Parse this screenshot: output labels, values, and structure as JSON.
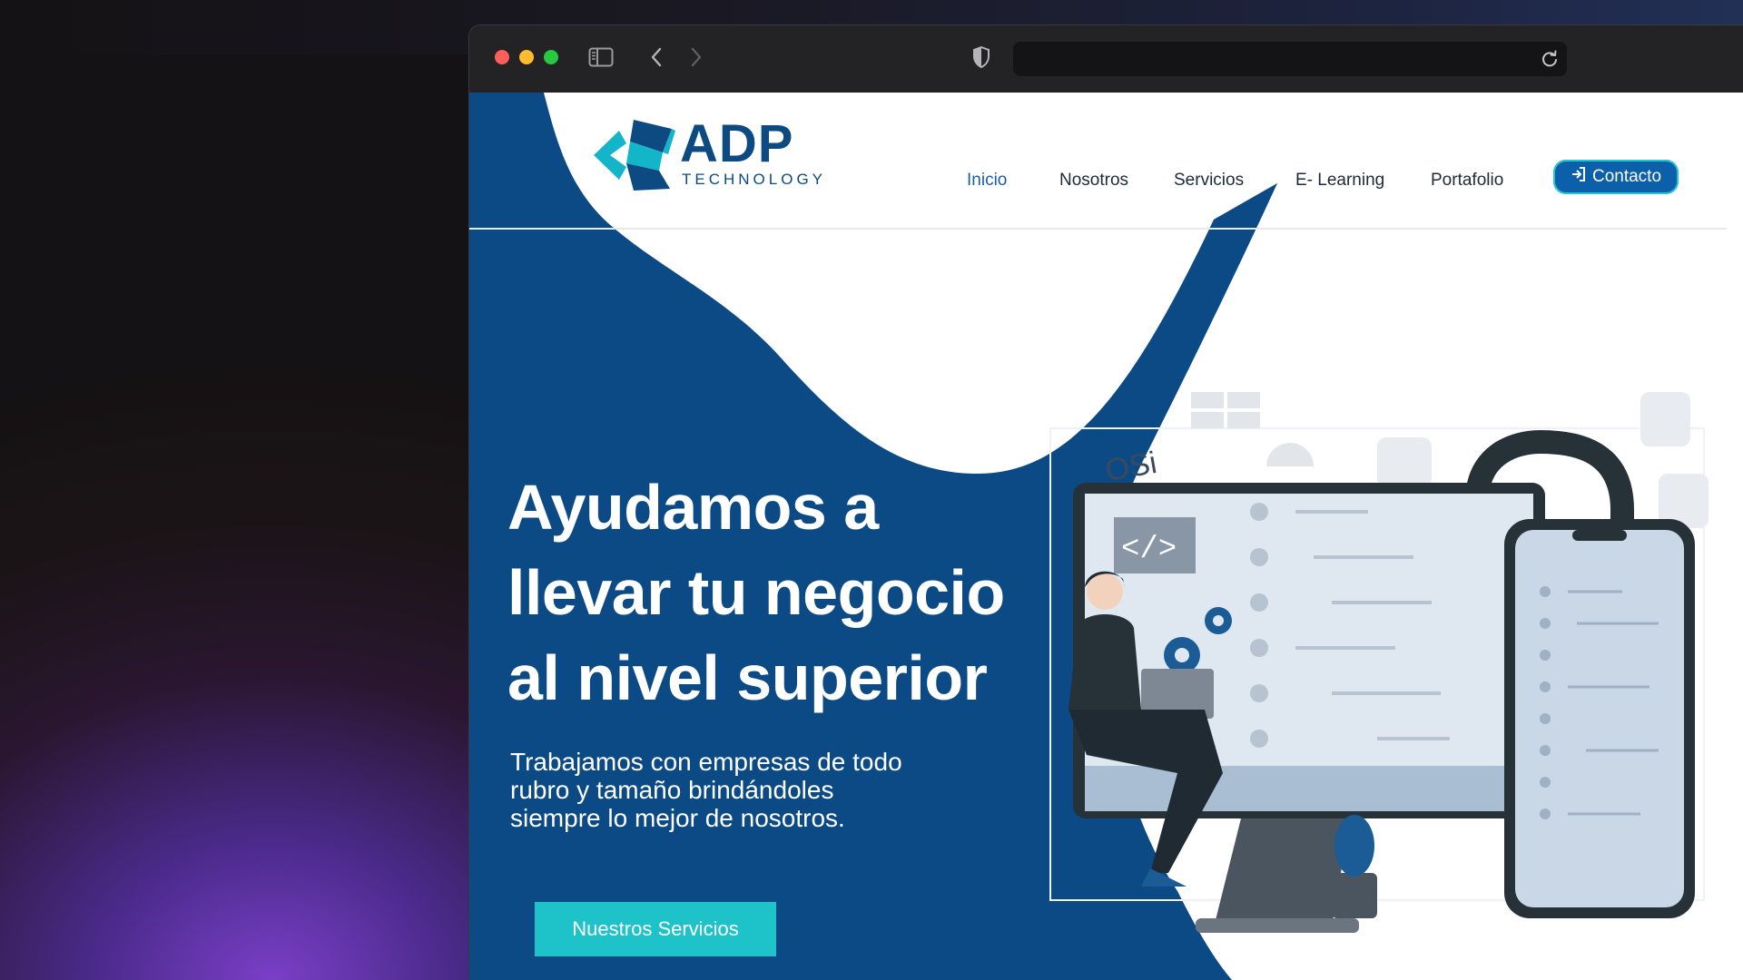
{
  "browser": {
    "url": ""
  },
  "nav": {
    "logo_text": "ADP",
    "logo_subtext": "TECHNOLOGY",
    "items": [
      {
        "label": "Inicio",
        "active": true
      },
      {
        "label": "Nosotros",
        "active": false
      },
      {
        "label": "Servicios",
        "active": false
      },
      {
        "label": "E- Learning",
        "active": false
      },
      {
        "label": "Portafolio",
        "active": false
      }
    ],
    "contact_label": "Contacto"
  },
  "hero": {
    "title_line1": "Ayudamos a",
    "title_line2": "llevar tu negocio",
    "title_line3": "al nivel superior",
    "subtitle_line1": "Trabajamos con empresas de todo",
    "subtitle_line2": "rubro y tamaño brindándoles",
    "subtitle_line3": "siempre lo mejor de nosotros.",
    "cta_label": "Nuestros Servicios"
  },
  "illustration": {
    "code_tag": "</>",
    "ios_label": "OSi"
  },
  "colors": {
    "brand_blue": "#0c4a85",
    "accent_teal": "#1dc3c8",
    "nav_active": "#1a5ea6"
  },
  "icons": [
    "sidebar-icon",
    "back-icon",
    "forward-icon",
    "shield-icon",
    "reload-icon",
    "login-icon"
  ]
}
